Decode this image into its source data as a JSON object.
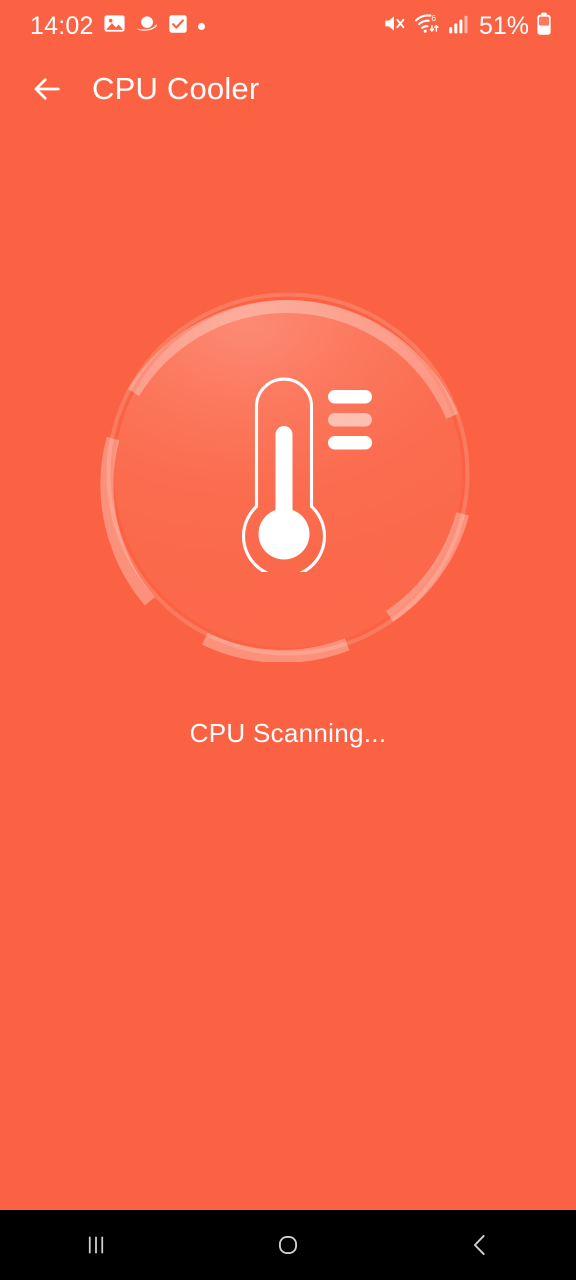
{
  "status_bar": {
    "clock": "14:02",
    "battery_percent": "51%",
    "left_icons": [
      "gallery-icon",
      "saturn-icon",
      "checkbox-icon",
      "notification-dot-icon"
    ],
    "right_icons": [
      "mute-icon",
      "wifi-icon",
      "signal-bars-icon",
      "battery-icon"
    ],
    "wifi_label": "6",
    "colors": {
      "foreground": "#ffffff"
    }
  },
  "app_bar": {
    "back_label": "back-arrow-icon",
    "title": "CPU Cooler"
  },
  "scan": {
    "status_text": "CPU Scanning...",
    "icon_name": "thermometer-icon",
    "ring_name": "scanning-progress-ring",
    "tick_marks": 3
  },
  "nav_bar": {
    "recents_label": "recents-icon",
    "home_label": "home-icon",
    "back_label": "back-icon"
  },
  "theme": {
    "background": "#fb6243",
    "accent": "#ffffff",
    "nav_background": "#000000",
    "ring_light": "rgba(255,255,255,0.30)"
  }
}
